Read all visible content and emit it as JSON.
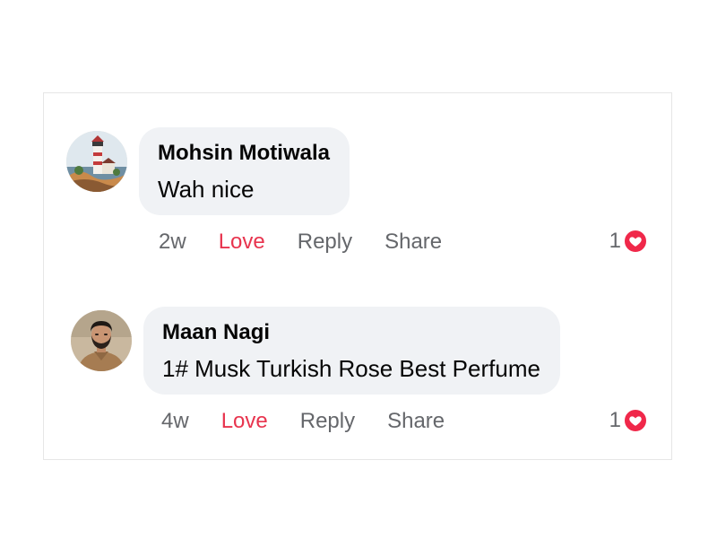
{
  "colors": {
    "bubble": "#f0f2f5",
    "love_active": "#e8344e",
    "action_text": "#65676b",
    "love_badge": "#f0284a"
  },
  "comments": [
    {
      "author": "Mohsin Motiwala",
      "text": "Wah nice",
      "time": "2w",
      "love_label": "Love",
      "reply_label": "Reply",
      "share_label": "Share",
      "reaction_count": "1",
      "reaction_icon": "heart-icon",
      "avatar": "lighthouse-painting-avatar"
    },
    {
      "author": "Maan Nagi",
      "text": "1# Musk Turkish Rose Best Perfume",
      "time": "4w",
      "love_label": "Love",
      "reply_label": "Reply",
      "share_label": "Share",
      "reaction_count": "1",
      "reaction_icon": "heart-icon",
      "avatar": "man-photo-avatar"
    }
  ]
}
